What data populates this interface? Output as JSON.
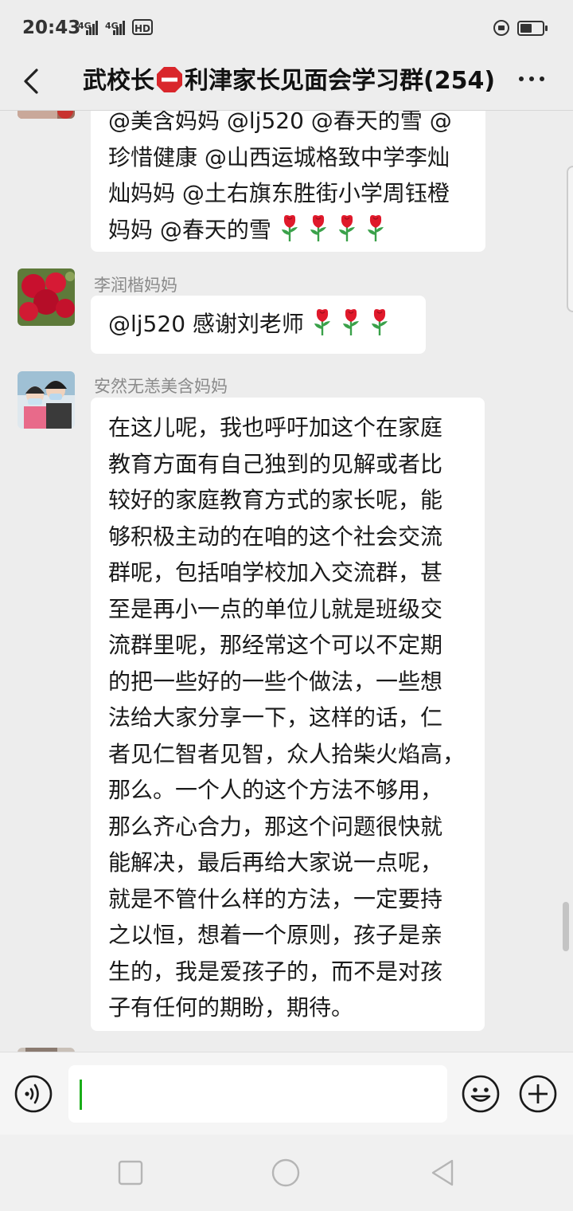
{
  "status_bar": {
    "time": "20:43",
    "signal1": "4G",
    "signal2": "4G",
    "hd": "HD",
    "battery_level": 0.55
  },
  "header": {
    "title_part1": "武校长",
    "title_part2": "利津家长见面会学习群(254)",
    "stop_icon": "stop-sign-icon",
    "back_icon": "chevron-left-icon",
    "more_icon": "more-dots-icon"
  },
  "messages": [
    {
      "sender": "",
      "lines": [
        "@美含妈妈 @lj520 @春天的雪 @",
        "珍惜健康 @山西运城格致中学李灿",
        "灿妈妈 @土右旗东胜街小学周钰橙",
        "妈妈 @春天的雪"
      ],
      "rose_count": 4
    },
    {
      "sender": "李润楷妈妈",
      "lines": [
        "@lj520 感谢刘老师"
      ],
      "rose_count": 3
    },
    {
      "sender": "安然无恙美含妈妈",
      "lines": [
        "在这儿呢，我也呼吁加这个在家庭",
        "教育方面有自己独到的见解或者比",
        "较好的家庭教育方式的家长呢，能",
        "够积极主动的在咱的这个社会交流",
        "群呢，包括咱学校加入交流群，甚",
        "至是再小一点的单位儿就是班级交",
        "流群里呢，那经常这个可以不定期",
        "的把一些好的一些个做法，一些想",
        "法给大家分享一下，这样的话，仁",
        "者见仁智者见智，众人拾柴火焰高，",
        "那么。一个人的这个方法不够用，",
        "那么齐心合力，那这个问题很快就",
        "能解决，最后再给大家说一点呢，",
        "就是不管什么样的方法，一定要持",
        "之以恒，想着一个原则，孩子是亲",
        "生的，我是爱孩子的，而不是对孩",
        "子有任何的期盼，期待。"
      ],
      "rose_count": 0
    }
  ],
  "input_bar": {
    "voice_icon": "voice-icon",
    "emoji_icon": "emoji-icon",
    "plus_icon": "plus-icon",
    "text_value": ""
  },
  "nav_bar": {
    "recents_icon": "square-icon",
    "home_icon": "circle-icon",
    "back_icon": "triangle-back-icon"
  }
}
